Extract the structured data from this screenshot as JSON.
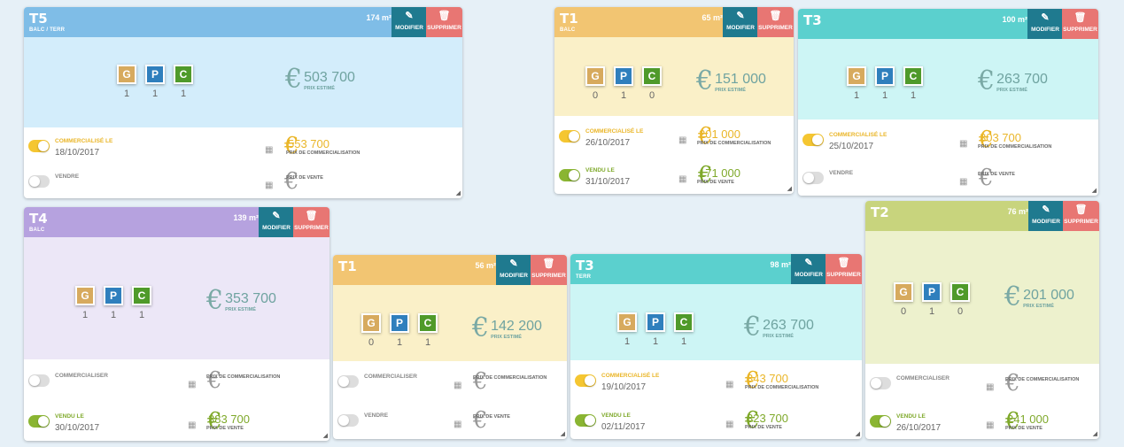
{
  "actions": {
    "modify": "MODIFIER",
    "delete": "SUPPRIMER"
  },
  "gpc": {
    "g": "G",
    "p": "P",
    "c": "C"
  },
  "labels": {
    "estimated": "PRIX ESTIMÉ",
    "price_commercial": "PRIX DE COMMERCIALISATION",
    "price_sale": "PRIX DE VENTE",
    "commercialized_on": "COMMERCIALISÉ LE",
    "commercialize": "COMMERCIALISER",
    "sold_on": "VENDU LE",
    "sell": "VENDRE"
  },
  "colors": {
    "blue": "#7fbde7",
    "orange": "#f2c572",
    "teal": "#5bd0ce",
    "purple": "#b6a2df",
    "olive": "#c8d47d",
    "yellow": "#f5c631",
    "green": "#8ab532"
  },
  "cards": [
    {
      "id": "t5",
      "title": "T5",
      "subtitle": "BALC / TERR",
      "area": "174 m²",
      "g": "1",
      "p": "1",
      "c": "1",
      "estimated_price": "503 700",
      "row1": {
        "label": "COMMERCIALISÉ LE",
        "date": "18/10/2017",
        "price": "553 700",
        "price_label": "PRIX DE COMMERCIALISATION"
      },
      "row2": {
        "label": "VENDRE",
        "date": "",
        "price": "",
        "price_label": "PRIX DE VENTE"
      }
    },
    {
      "id": "t1a",
      "title": "T1",
      "subtitle": "BALC",
      "area": "65 m²",
      "g": "0",
      "p": "1",
      "c": "0",
      "estimated_price": "151 000",
      "row1": {
        "label": "COMMERCIALISÉ LE",
        "date": "26/10/2017",
        "price": "201 000",
        "price_label": "PRIX DE COMMERCIALISATION"
      },
      "row2": {
        "label": "VENDU LE",
        "date": "31/10/2017",
        "price": "171 000",
        "price_label": "PRIX DE VENTE"
      }
    },
    {
      "id": "t3a",
      "title": "T3",
      "subtitle": "",
      "area": "100 m²",
      "g": "1",
      "p": "1",
      "c": "1",
      "estimated_price": "263 700",
      "row1": {
        "label": "COMMERCIALISÉ LE",
        "date": "25/10/2017",
        "price": "303 700",
        "price_label": "PRIX DE COMMERCIALISATION"
      },
      "row2": {
        "label": "VENDRE",
        "date": "",
        "price": "",
        "price_label": "PRIX DE VENTE"
      }
    },
    {
      "id": "t4",
      "title": "T4",
      "subtitle": "BALC",
      "area": "139 m²",
      "g": "1",
      "p": "1",
      "c": "1",
      "estimated_price": "353 700",
      "row1": {
        "label": "COMMERCIALISER",
        "date": "",
        "price": "",
        "price_label": "PRIX DE COMMERCIALISATION"
      },
      "row2": {
        "label": "VENDU LE",
        "date": "30/10/2017",
        "price": "383 700",
        "price_label": "PRIX DE VENTE"
      }
    },
    {
      "id": "t1b",
      "title": "T1",
      "subtitle": "",
      "area": "56 m²",
      "g": "0",
      "p": "1",
      "c": "1",
      "estimated_price": "142 200",
      "row1": {
        "label": "COMMERCIALISER",
        "date": "",
        "price": "",
        "price_label": "PRIX DE COMMERCIALISATION"
      },
      "row2": {
        "label": "VENDRE",
        "date": "",
        "price": "",
        "price_label": "PRIX DE VENTE"
      }
    },
    {
      "id": "t3b",
      "title": "T3",
      "subtitle": "TERR",
      "area": "98 m²",
      "g": "1",
      "p": "1",
      "c": "1",
      "estimated_price": "263 700",
      "row1": {
        "label": "COMMERCIALISÉ LE",
        "date": "19/10/2017",
        "price": "343 700",
        "price_label": "PRIX DE COMMERCIALISATION"
      },
      "row2": {
        "label": "VENDU LE",
        "date": "02/11/2017",
        "price": "323 700",
        "price_label": "PRIX DE VENTE"
      }
    },
    {
      "id": "t2",
      "title": "T2",
      "subtitle": "",
      "area": "76 m²",
      "g": "0",
      "p": "1",
      "c": "0",
      "estimated_price": "201 000",
      "row1": {
        "label": "COMMERCIALISER",
        "date": "",
        "price": "",
        "price_label": "PRIX DE COMMERCIALISATION"
      },
      "row2": {
        "label": "VENDU LE",
        "date": "26/10/2017",
        "price": "241 000",
        "price_label": "PRIX DE VENTE"
      }
    }
  ]
}
